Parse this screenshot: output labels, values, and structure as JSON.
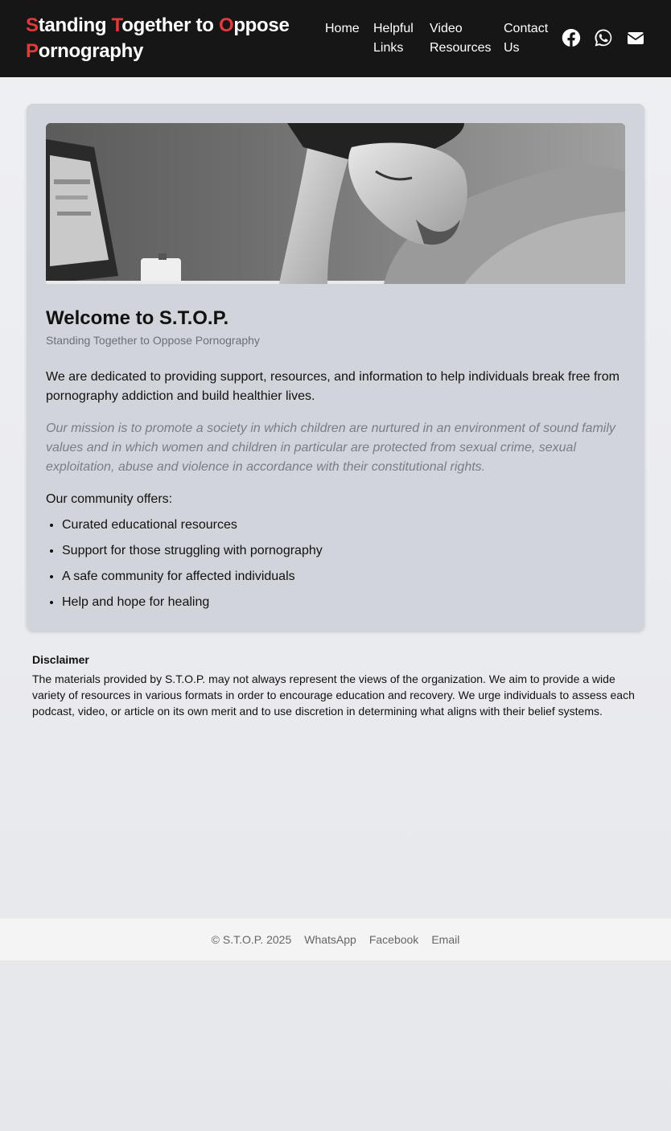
{
  "header": {
    "brand_lines": [
      [
        {
          "letter": "S",
          "rest": "tanding "
        },
        {
          "letter": "T",
          "rest": "ogether to "
        },
        {
          "letter": "O",
          "rest": "ppose"
        }
      ],
      [
        {
          "letter": "P",
          "rest": "ornography"
        }
      ]
    ],
    "nav": [
      {
        "label": "Home"
      },
      {
        "label": "Helpful Links"
      },
      {
        "label": "Video Resources"
      },
      {
        "label": "Contact Us"
      }
    ],
    "social_icons": [
      "facebook-icon",
      "whatsapp-icon",
      "email-icon"
    ],
    "accent_color": "#e03b3b"
  },
  "main": {
    "title": "Welcome to S.T.O.P.",
    "subtitle": "Standing Together to Oppose Pornography",
    "intro": "We are dedicated to providing support, resources, and information to help individuals break free from pornography addiction and build healthier lives.",
    "mission": "Our mission is to promote a society in which children are nurtured in an environment of sound family values and in which women and children in particular are protected from sexual crime, sexual exploitation, abuse and violence in accordance with their constitutional rights.",
    "offers_label": "Our community offers:",
    "offers": [
      "Curated educational resources",
      "Support for those struggling with pornography",
      "A safe community for affected individuals",
      "Help and hope for healing"
    ]
  },
  "disclaimer": {
    "title": "Disclaimer",
    "text": "The materials provided by S.T.O.P. may not always represent the views of the organization. We aim to provide a wide variety of resources in various formats in order to encourage education and recovery. We urge individuals to assess each podcast, video, or article on its own merit and to use discretion in determining what aligns with their belief systems."
  },
  "footer": {
    "copyright": "© S.T.O.P. 2025",
    "links": [
      "WhatsApp",
      "Facebook",
      "Email"
    ]
  }
}
